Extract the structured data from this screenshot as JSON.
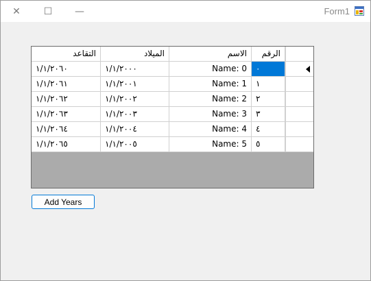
{
  "window": {
    "title": "Form1",
    "close_glyph": "✕",
    "maximize_glyph": "☐",
    "minimize_glyph": "—"
  },
  "grid": {
    "columns": [
      "الرقم",
      "الاسم",
      "الميلاد",
      "التقاعد"
    ],
    "rows": [
      {
        "id": "٠",
        "name": "Name: 0",
        "birth": "١/١/٢٠٠٠",
        "retire": "١/١/٢٠٦٠",
        "selected": true
      },
      {
        "id": "١",
        "name": "Name: 1",
        "birth": "١/١/٢٠٠١",
        "retire": "١/١/٢٠٦١"
      },
      {
        "id": "٢",
        "name": "Name: 2",
        "birth": "١/١/٢٠٠٢",
        "retire": "١/١/٢٠٦٢"
      },
      {
        "id": "٣",
        "name": "Name: 3",
        "birth": "١/١/٢٠٠٣",
        "retire": "١/١/٢٠٦٣"
      },
      {
        "id": "٤",
        "name": "Name: 4",
        "birth": "١/١/٢٠٠٤",
        "retire": "١/١/٢٠٦٤"
      },
      {
        "id": "٥",
        "name": "Name: 5",
        "birth": "١/١/٢٠٠٥",
        "retire": "١/١/٢٠٦٥"
      }
    ],
    "selection_color": "#0078d7"
  },
  "buttons": {
    "add_years": "Add Years"
  },
  "icons": {
    "close": "close-icon",
    "maximize": "maximize-icon",
    "minimize": "minimize-icon",
    "app": "app-icon",
    "current_row": "row-pointer-icon"
  }
}
